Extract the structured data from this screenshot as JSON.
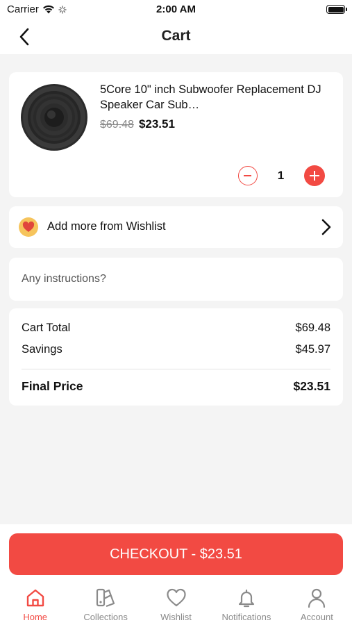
{
  "status_bar": {
    "carrier": "Carrier",
    "time": "2:00 AM"
  },
  "nav": {
    "title": "Cart"
  },
  "cart_item": {
    "name": "5Core 10\" inch Subwoofer Replacement DJ Speaker Car Sub…",
    "old_price": "$69.48",
    "price": "$23.51",
    "quantity": "1"
  },
  "wishlist": {
    "label": "Add more from Wishlist"
  },
  "instructions": {
    "placeholder": "Any instructions?"
  },
  "summary": {
    "cart_total_label": "Cart Total",
    "cart_total_value": "$69.48",
    "savings_label": "Savings",
    "savings_value": "$45.97",
    "final_label": "Final Price",
    "final_value": "$23.51"
  },
  "checkout": {
    "label": "CHECKOUT - $23.51"
  },
  "tabs": [
    {
      "label": "Home",
      "icon": "home-icon",
      "active": true
    },
    {
      "label": "Collections",
      "icon": "collections-icon",
      "active": false
    },
    {
      "label": "Wishlist",
      "icon": "heart-icon",
      "active": false
    },
    {
      "label": "Notifications",
      "icon": "bell-icon",
      "active": false
    },
    {
      "label": "Account",
      "icon": "user-icon",
      "active": false
    }
  ],
  "colors": {
    "accent": "#f24a43",
    "background": "#f4f4f4",
    "card": "#ffffff"
  }
}
